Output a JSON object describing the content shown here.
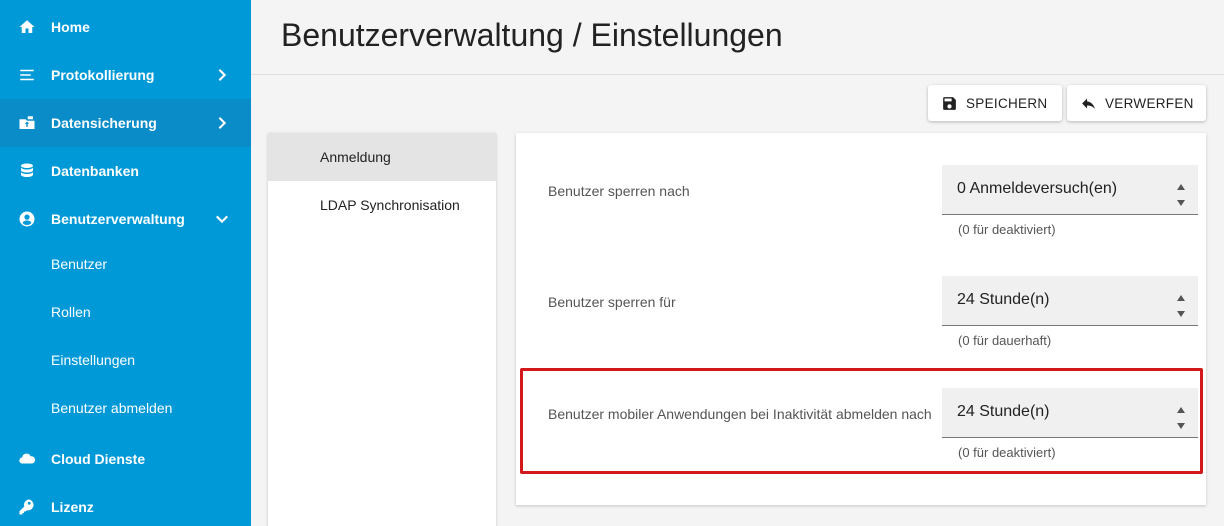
{
  "sidebar": {
    "items": [
      {
        "label": "Home",
        "icon": "home-icon"
      },
      {
        "label": "Protokollierung",
        "icon": "list-icon"
      },
      {
        "label": "Datensicherung",
        "icon": "backup-icon"
      },
      {
        "label": "Datenbanken",
        "icon": "database-icon"
      },
      {
        "label": "Benutzerverwaltung",
        "icon": "user-circle-icon"
      },
      {
        "label": "Benutzer"
      },
      {
        "label": "Rollen"
      },
      {
        "label": "Einstellungen"
      },
      {
        "label": "Benutzer abmelden"
      },
      {
        "label": "Cloud Dienste",
        "icon": "cloud-icon"
      },
      {
        "label": "Lizenz",
        "icon": "key-icon"
      }
    ]
  },
  "header": {
    "title": "Benutzerverwaltung / Einstellungen"
  },
  "toolbar": {
    "save_label": "SPEICHERN",
    "discard_label": "VERWERFEN"
  },
  "submenu": {
    "items": [
      {
        "label": "Anmeldung"
      },
      {
        "label": "LDAP Synchronisation"
      }
    ]
  },
  "settings": {
    "rows": [
      {
        "label": "Benutzer sperren nach",
        "value": "0 Anmeldeversuch(en)",
        "hint": "(0 für deaktiviert)"
      },
      {
        "label": "Benutzer sperren für",
        "value": "24 Stunde(n)",
        "hint": "(0 für dauerhaft)"
      },
      {
        "label": "Benutzer mobiler Anwendungen bei Inaktivität abmelden nach",
        "value": "24 Stunde(n)",
        "hint": "(0 für deaktiviert)"
      }
    ]
  },
  "colors": {
    "sidebar": "#0099d8",
    "highlight": "#d2181b"
  }
}
